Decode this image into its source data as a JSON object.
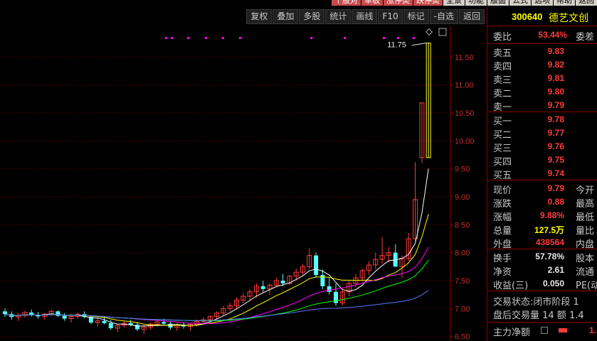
{
  "top_tabs": [
    "个股对",
    "单板",
    "涨停类",
    "跌停类",
    "全景",
    "功能",
    "版面",
    "公式",
    "选项",
    "帮助",
    "返回"
  ],
  "toolbar": [
    "复权",
    "叠加",
    "多股",
    "统计",
    "画线",
    "F10",
    "标记",
    "-自选",
    "返回"
  ],
  "stock": {
    "code": "300640",
    "name": "德艺文创"
  },
  "chart_data": {
    "type": "candlestick",
    "y_ticks": [
      "11.50",
      "11.00",
      "10.50",
      "10.00",
      "9.50",
      "9.00",
      "8.50",
      "8.00",
      "7.50",
      "7.00",
      "6.50"
    ],
    "ylim": [
      6.42,
      12.05
    ],
    "max_label": "11.75",
    "candles_note": "recent daily OHLC, last two candles limit-up",
    "candles": [
      [
        6.95,
        7.0,
        6.85,
        6.9
      ],
      [
        6.9,
        6.95,
        6.8,
        6.85
      ],
      [
        6.85,
        6.92,
        6.78,
        6.88
      ],
      [
        6.88,
        6.96,
        6.84,
        6.93
      ],
      [
        6.93,
        6.98,
        6.86,
        6.88
      ],
      [
        6.88,
        6.94,
        6.82,
        6.86
      ],
      [
        6.86,
        6.92,
        6.8,
        6.9
      ],
      [
        6.9,
        6.98,
        6.87,
        6.95
      ],
      [
        6.95,
        6.97,
        6.85,
        6.87
      ],
      [
        6.87,
        6.92,
        6.78,
        6.82
      ],
      [
        6.82,
        6.9,
        6.75,
        6.86
      ],
      [
        6.86,
        6.93,
        6.82,
        6.9
      ],
      [
        6.9,
        6.95,
        6.83,
        6.85
      ],
      [
        6.85,
        6.88,
        6.72,
        6.75
      ],
      [
        6.75,
        6.82,
        6.68,
        6.78
      ],
      [
        6.78,
        6.85,
        6.72,
        6.74
      ],
      [
        6.74,
        6.8,
        6.62,
        6.65
      ],
      [
        6.65,
        6.72,
        6.58,
        6.7
      ],
      [
        6.7,
        6.78,
        6.66,
        6.74
      ],
      [
        6.74,
        6.8,
        6.68,
        6.71
      ],
      [
        6.71,
        6.76,
        6.6,
        6.63
      ],
      [
        6.63,
        6.7,
        6.55,
        6.67
      ],
      [
        6.67,
        6.75,
        6.62,
        6.72
      ],
      [
        6.72,
        6.8,
        6.68,
        6.76
      ],
      [
        6.76,
        6.82,
        6.7,
        6.73
      ],
      [
        6.73,
        6.78,
        6.62,
        6.66
      ],
      [
        6.66,
        6.74,
        6.6,
        6.7
      ],
      [
        6.7,
        6.76,
        6.64,
        6.68
      ],
      [
        6.68,
        6.74,
        6.6,
        6.72
      ],
      [
        6.72,
        6.8,
        6.68,
        6.77
      ],
      [
        6.77,
        6.84,
        6.72,
        6.8
      ],
      [
        6.8,
        6.88,
        6.76,
        6.86
      ],
      [
        6.86,
        6.95,
        6.82,
        6.92
      ],
      [
        6.92,
        7.05,
        6.88,
        7.0
      ],
      [
        7.0,
        7.1,
        6.95,
        7.05
      ],
      [
        7.05,
        7.2,
        7.0,
        7.15
      ],
      [
        7.15,
        7.28,
        7.1,
        7.22
      ],
      [
        7.22,
        7.35,
        7.15,
        7.3
      ],
      [
        7.3,
        7.45,
        7.2,
        7.4
      ],
      [
        7.4,
        7.5,
        7.3,
        7.35
      ],
      [
        7.35,
        7.45,
        7.25,
        7.42
      ],
      [
        7.42,
        7.55,
        7.38,
        7.5
      ],
      [
        7.5,
        7.62,
        7.4,
        7.45
      ],
      [
        7.45,
        7.6,
        7.42,
        7.58
      ],
      [
        7.58,
        7.72,
        7.5,
        7.65
      ],
      [
        7.65,
        7.8,
        7.6,
        7.75
      ],
      [
        7.75,
        8.08,
        7.7,
        7.95
      ],
      [
        7.95,
        8.0,
        7.55,
        7.6
      ],
      [
        7.6,
        7.7,
        7.35,
        7.4
      ],
      [
        7.4,
        7.55,
        7.25,
        7.3
      ],
      [
        7.3,
        7.45,
        7.05,
        7.1
      ],
      [
        7.1,
        7.35,
        7.05,
        7.3
      ],
      [
        7.3,
        7.5,
        7.22,
        7.45
      ],
      [
        7.45,
        7.62,
        7.38,
        7.55
      ],
      [
        7.55,
        7.72,
        7.48,
        7.68
      ],
      [
        7.68,
        7.85,
        7.6,
        7.78
      ],
      [
        7.78,
        8.0,
        7.7,
        7.88
      ],
      [
        7.88,
        8.28,
        7.8,
        7.95
      ],
      [
        7.95,
        8.1,
        7.82,
        8.0
      ],
      [
        8.0,
        8.15,
        7.9,
        7.75
      ],
      [
        7.75,
        7.95,
        7.55,
        7.9
      ],
      [
        7.9,
        8.35,
        7.85,
        8.25
      ],
      [
        8.25,
        9.62,
        8.2,
        8.95
      ],
      [
        9.7,
        10.68,
        9.6,
        10.68
      ],
      [
        9.7,
        11.75,
        9.7,
        11.75
      ]
    ]
  },
  "quote": {
    "wei_bi_label": "委比",
    "wei_bi": "53.44%",
    "wei_cha_label": "委差",
    "asks": [
      {
        "label": "卖五",
        "price": "9.83"
      },
      {
        "label": "卖四",
        "price": "9.82"
      },
      {
        "label": "卖三",
        "price": "9.81"
      },
      {
        "label": "卖二",
        "price": "9.80"
      },
      {
        "label": "卖一",
        "price": "9.79"
      }
    ],
    "bids": [
      {
        "label": "买一",
        "price": "9.78"
      },
      {
        "label": "买二",
        "price": "9.77"
      },
      {
        "label": "买三",
        "price": "9.76"
      },
      {
        "label": "买四",
        "price": "9.75"
      },
      {
        "label": "买五",
        "price": "9.74"
      }
    ],
    "stats": [
      {
        "label": "现价",
        "value": "9.79",
        "right": "今开"
      },
      {
        "label": "涨跌",
        "value": "0.88",
        "right": "最高"
      },
      {
        "label": "涨幅",
        "value": "9.88%",
        "right": "最低"
      },
      {
        "label": "总量",
        "value": "127.5万",
        "right": "量比"
      },
      {
        "label": "外盘",
        "value": "438564",
        "right": "内盘"
      }
    ],
    "fund": [
      {
        "label": "换手",
        "value": "57.78%",
        "right": "股本"
      },
      {
        "label": "净资",
        "value": "2.61",
        "right": "流通"
      },
      {
        "label": "收益(三)",
        "value": "0.050",
        "right": "PE(动"
      }
    ],
    "trade_status": "交易状态:闭市阶段 1",
    "after_hours": "盘后交易量 14 额 1.4",
    "main_net": "主力净额",
    "main_net_val": "1."
  }
}
